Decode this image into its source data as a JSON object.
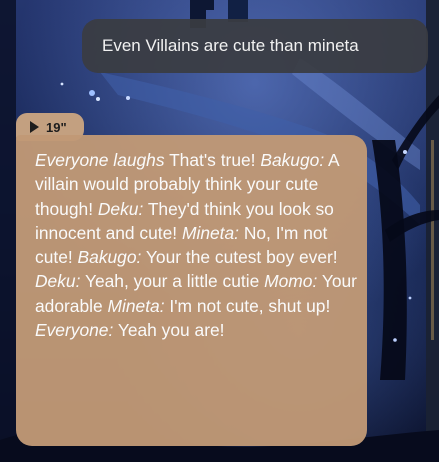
{
  "user_message": {
    "text": "Even Villains are cute than mineta"
  },
  "ai_message": {
    "audio_duration": "19\"",
    "segments": [
      {
        "text": "Everyone laughs",
        "italic": true
      },
      {
        "text": " That's true! ",
        "italic": false
      },
      {
        "text": "Bakugo:",
        "italic": true
      },
      {
        "text": " A villain would probably think your cute though! ",
        "italic": false
      },
      {
        "text": "Deku:",
        "italic": true
      },
      {
        "text": " They'd think you look so innocent and cute! ",
        "italic": false
      },
      {
        "text": "Mineta:",
        "italic": true
      },
      {
        "text": " No, I'm not cute! ",
        "italic": false
      },
      {
        "text": "Bakugo:",
        "italic": true
      },
      {
        "text": " Your the cutest boy ever! ",
        "italic": false
      },
      {
        "text": "Deku:",
        "italic": true
      },
      {
        "text": " Yeah, your a little cutie ",
        "italic": false
      },
      {
        "text": "Momo:",
        "italic": true
      },
      {
        "text": " Your adorable ",
        "italic": false
      },
      {
        "text": "Mineta:",
        "italic": true
      },
      {
        "text": " I'm not cute, shut up! ",
        "italic": false
      },
      {
        "text": "Everyone:",
        "italic": true
      },
      {
        "text": " Yeah you are!",
        "italic": false
      }
    ]
  },
  "colors": {
    "user_bubble": "#3a3c42",
    "ai_bubble": "#c19976",
    "audio_badge": "#c3a080",
    "background": "#0c1330"
  },
  "icons": {
    "audio": "play-icon"
  }
}
